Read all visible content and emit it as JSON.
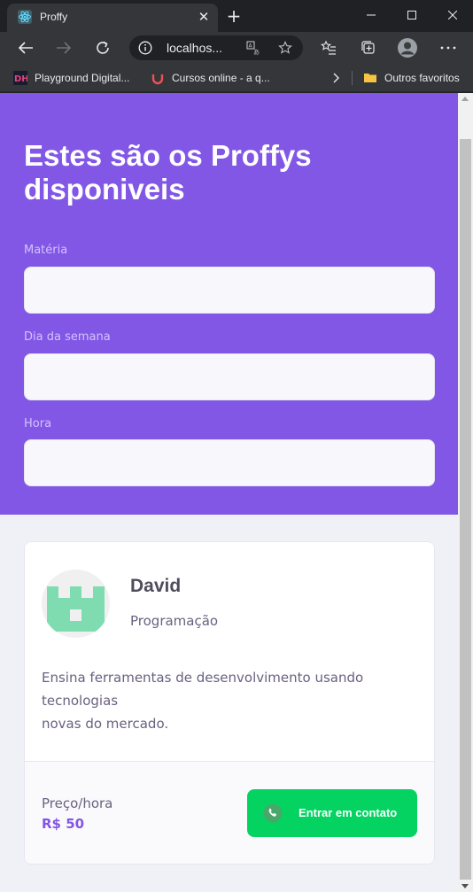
{
  "browser": {
    "tab_title": "Proffy",
    "url": "localhos...",
    "bookmarks": [
      {
        "label": "Playground Digital..."
      },
      {
        "label": "Cursos online - a q..."
      }
    ],
    "other_favorites": "Outros favoritos"
  },
  "page": {
    "title": "Estes são os Proffys disponiveis",
    "filters": [
      {
        "label": "Matéria",
        "value": ""
      },
      {
        "label": "Dia da semana",
        "value": ""
      },
      {
        "label": "Hora",
        "value": ""
      }
    ],
    "teacher": {
      "name": "David",
      "subject": "Programação",
      "bio_line1": "Ensina ferramentas de desenvolvimento usando tecnologias",
      "bio_line2": "novas do mercado.",
      "price_label": "Preço/hora",
      "price_value": "R$ 50",
      "contact_label": "Entrar em contato"
    }
  },
  "colors": {
    "primary": "#8257e5",
    "secondary": "#04d361",
    "background": "#f0f0f7"
  }
}
